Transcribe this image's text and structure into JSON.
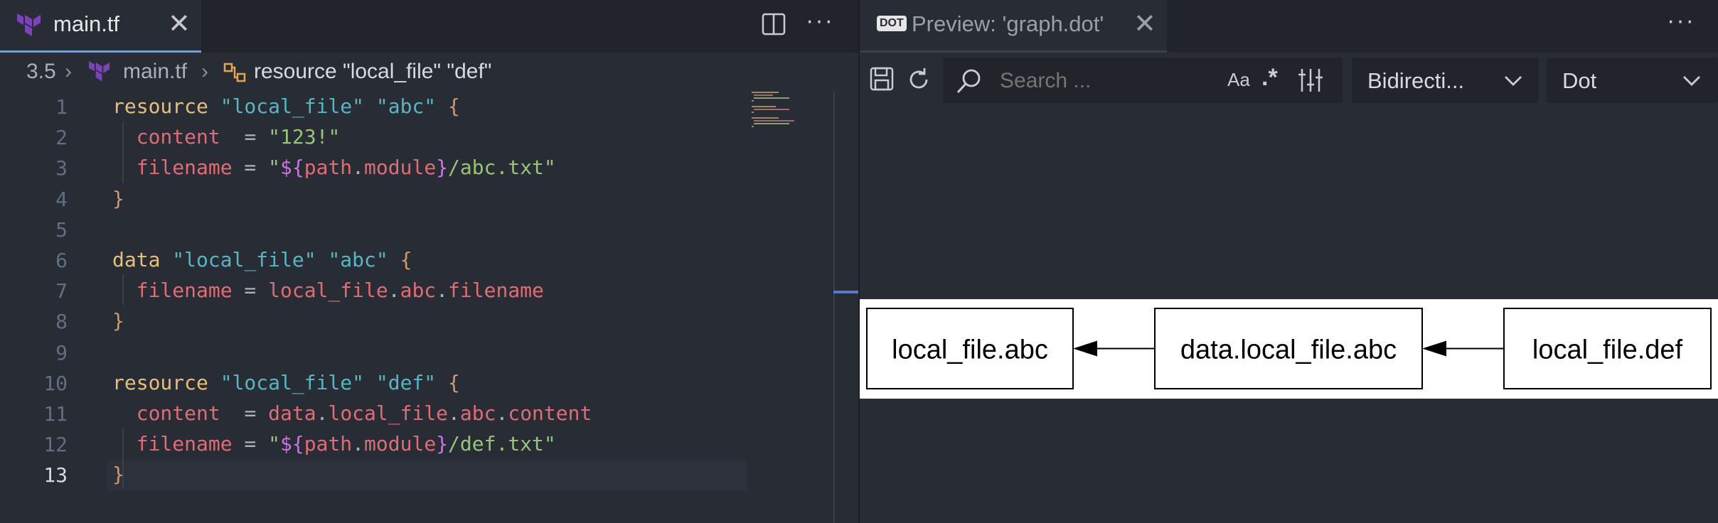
{
  "editor": {
    "tab": {
      "title": "main.tf"
    },
    "breadcrumb": {
      "folder": "3.5",
      "file": "main.tf",
      "symbol": "resource \"local_file\" \"def\""
    },
    "code_lines": [
      {
        "number": "1",
        "tokens": [
          [
            "kw",
            "resource"
          ],
          [
            "op",
            " "
          ],
          [
            "str",
            "\"local_file\""
          ],
          [
            "op",
            " "
          ],
          [
            "str",
            "\"abc\""
          ],
          [
            "op",
            " "
          ],
          [
            "brace",
            "{"
          ]
        ]
      },
      {
        "number": "2",
        "tokens": [
          [
            "op",
            "  "
          ],
          [
            "attr",
            "content"
          ],
          [
            "op",
            "  = "
          ],
          [
            "val",
            "\"123!\""
          ]
        ]
      },
      {
        "number": "3",
        "tokens": [
          [
            "op",
            "  "
          ],
          [
            "attr",
            "filename"
          ],
          [
            "op",
            " = "
          ],
          [
            "val",
            "\""
          ],
          [
            "interp",
            "${"
          ],
          [
            "attr",
            "path"
          ],
          [
            "op",
            "."
          ],
          [
            "attr",
            "module"
          ],
          [
            "interp",
            "}"
          ],
          [
            "val",
            "/abc.txt\""
          ]
        ]
      },
      {
        "number": "4",
        "tokens": [
          [
            "brace",
            "}"
          ]
        ]
      },
      {
        "number": "5",
        "tokens": []
      },
      {
        "number": "6",
        "tokens": [
          [
            "kw",
            "data"
          ],
          [
            "op",
            " "
          ],
          [
            "str",
            "\"local_file\""
          ],
          [
            "op",
            " "
          ],
          [
            "str",
            "\"abc\""
          ],
          [
            "op",
            " "
          ],
          [
            "brace",
            "{"
          ]
        ]
      },
      {
        "number": "7",
        "tokens": [
          [
            "op",
            "  "
          ],
          [
            "attr",
            "filename"
          ],
          [
            "op",
            " = "
          ],
          [
            "attr",
            "local_file"
          ],
          [
            "op",
            "."
          ],
          [
            "attr",
            "abc"
          ],
          [
            "op",
            "."
          ],
          [
            "attr",
            "filename"
          ]
        ]
      },
      {
        "number": "8",
        "tokens": [
          [
            "brace",
            "}"
          ]
        ]
      },
      {
        "number": "9",
        "tokens": []
      },
      {
        "number": "10",
        "tokens": [
          [
            "kw",
            "resource"
          ],
          [
            "op",
            " "
          ],
          [
            "str",
            "\"local_file\""
          ],
          [
            "op",
            " "
          ],
          [
            "str",
            "\"def\""
          ],
          [
            "op",
            " "
          ],
          [
            "brace",
            "{"
          ]
        ]
      },
      {
        "number": "11",
        "tokens": [
          [
            "op",
            "  "
          ],
          [
            "attr",
            "content"
          ],
          [
            "op",
            "  = "
          ],
          [
            "attr",
            "data"
          ],
          [
            "op",
            "."
          ],
          [
            "attr",
            "local_file"
          ],
          [
            "op",
            "."
          ],
          [
            "attr",
            "abc"
          ],
          [
            "op",
            "."
          ],
          [
            "attr",
            "content"
          ]
        ]
      },
      {
        "number": "12",
        "tokens": [
          [
            "op",
            "  "
          ],
          [
            "attr",
            "filename"
          ],
          [
            "op",
            " = "
          ],
          [
            "val",
            "\""
          ],
          [
            "interp",
            "${"
          ],
          [
            "attr",
            "path"
          ],
          [
            "op",
            "."
          ],
          [
            "attr",
            "module"
          ],
          [
            "interp",
            "}"
          ],
          [
            "val",
            "/def.txt\""
          ]
        ]
      },
      {
        "number": "13",
        "tokens": [
          [
            "brace",
            "}"
          ]
        ]
      }
    ],
    "active_line": "13"
  },
  "preview": {
    "tab": {
      "badge": "DOT",
      "title": "Preview: 'graph.dot'"
    },
    "toolbar": {
      "search_placeholder": "Search ...",
      "match_case_label": "Aa",
      "regex_label": ".*",
      "direction_value": "Bidirecti...",
      "engine_value": "Dot"
    },
    "graph": {
      "nodes": [
        "local_file.abc",
        "data.local_file.abc",
        "local_file.def"
      ],
      "edges": [
        [
          "data.local_file.abc",
          "local_file.abc"
        ],
        [
          "local_file.def",
          "data.local_file.abc"
        ]
      ]
    }
  },
  "colors": {
    "accent": "#5ea1ff",
    "terraform_purple": "#7b42bc",
    "keyword": "#e5c07b",
    "string": "#56b6c2",
    "attribute": "#e06c75",
    "value": "#98c379"
  }
}
